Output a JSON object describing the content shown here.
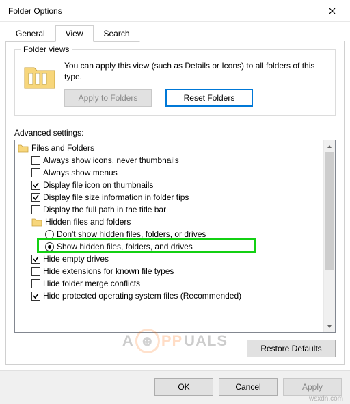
{
  "window": {
    "title": "Folder Options"
  },
  "tabs": {
    "general": "General",
    "view": "View",
    "search": "Search"
  },
  "folder_views": {
    "legend": "Folder views",
    "desc": "You can apply this view (such as Details or Icons) to all folders of this type.",
    "apply_btn": "Apply to Folders",
    "reset_btn": "Reset Folders"
  },
  "advanced": {
    "label": "Advanced settings:",
    "root": "Files and Folders",
    "items": [
      {
        "kind": "check",
        "checked": false,
        "label": "Always show icons, never thumbnails"
      },
      {
        "kind": "check",
        "checked": false,
        "label": "Always show menus"
      },
      {
        "kind": "check",
        "checked": true,
        "label": "Display file icon on thumbnails"
      },
      {
        "kind": "check",
        "checked": true,
        "label": "Display file size information in folder tips"
      },
      {
        "kind": "check",
        "checked": false,
        "label": "Display the full path in the title bar"
      },
      {
        "kind": "folder",
        "label": "Hidden files and folders"
      },
      {
        "kind": "radio",
        "checked": false,
        "label": "Don't show hidden files, folders, or drives"
      },
      {
        "kind": "radio",
        "checked": true,
        "label": "Show hidden files, folders, and drives",
        "highlight": true
      },
      {
        "kind": "check",
        "checked": true,
        "label": "Hide empty drives"
      },
      {
        "kind": "check",
        "checked": false,
        "label": "Hide extensions for known file types"
      },
      {
        "kind": "check",
        "checked": false,
        "label": "Hide folder merge conflicts"
      },
      {
        "kind": "check",
        "checked": true,
        "label": "Hide protected operating system files (Recommended)"
      }
    ],
    "restore_btn": "Restore Defaults"
  },
  "footer": {
    "ok": "OK",
    "cancel": "Cancel",
    "apply": "Apply"
  },
  "watermark": {
    "a": "A",
    "pp": "PP",
    "uals": "UALS"
  },
  "source": "wsxdn.com"
}
